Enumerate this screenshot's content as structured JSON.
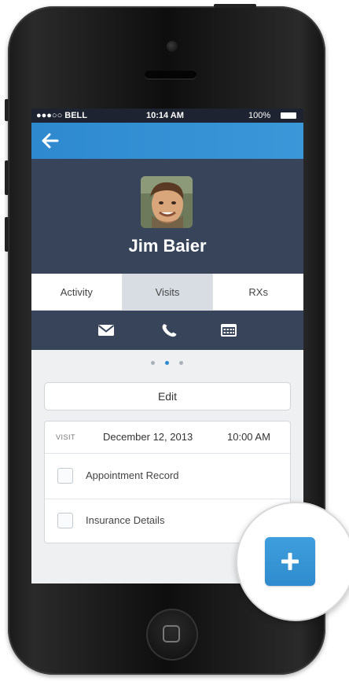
{
  "status_bar": {
    "carrier": "●●●○○ BELL",
    "time": "10:14 AM",
    "battery": "100%"
  },
  "profile": {
    "name": "Jim Baier"
  },
  "tabs": [
    {
      "label": "Activity",
      "active": false
    },
    {
      "label": "Visits",
      "active": true
    },
    {
      "label": "RXs",
      "active": false
    }
  ],
  "action_icons": [
    "mail-icon",
    "phone-icon",
    "calendar-icon"
  ],
  "pager": {
    "count": 3,
    "active_index": 1
  },
  "edit_button": {
    "label": "Edit"
  },
  "visit": {
    "tag": "VISIT",
    "date": "December 12, 2013",
    "time": "10:00 AM",
    "items": [
      {
        "label": "Appointment Record",
        "checked": false
      },
      {
        "label": "Insurance Details",
        "checked": false
      }
    ]
  },
  "fab": {
    "icon": "plus-icon"
  },
  "colors": {
    "accent": "#2e89cf",
    "header_dark": "#37445a",
    "tab_active": "#d7dde3"
  }
}
